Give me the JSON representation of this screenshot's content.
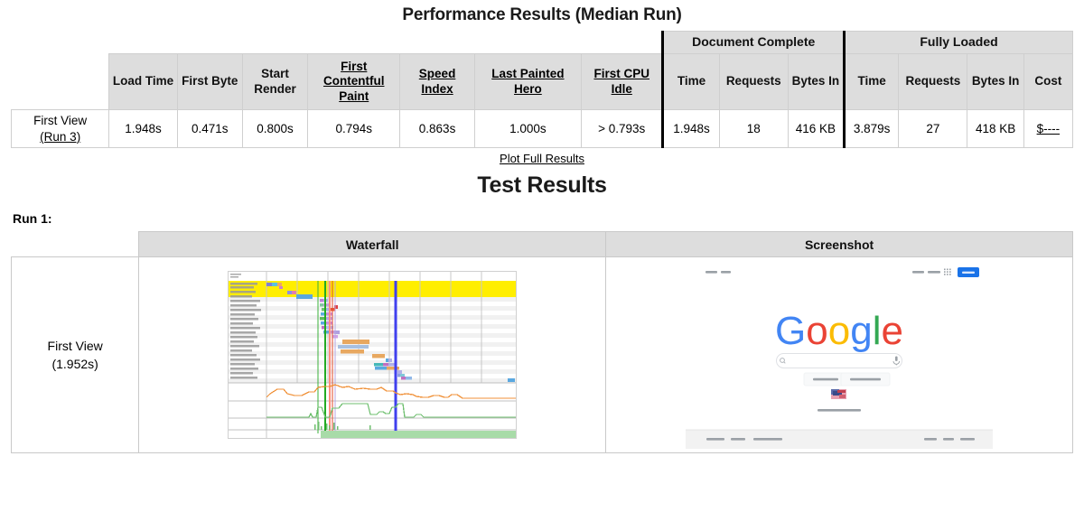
{
  "page": {
    "performance_title": "Performance Results (Median Run)",
    "test_results_title": "Test Results",
    "plot_full_results_link": "Plot Full Results",
    "run_label": "Run 1:"
  },
  "perf_table": {
    "group_headers": [
      {
        "label": "",
        "span": 8
      },
      {
        "label": "Document Complete",
        "span": 3
      },
      {
        "label": "Fully Loaded",
        "span": 4
      }
    ],
    "column_headers": [
      {
        "label": "",
        "link": false
      },
      {
        "label": "Load Time",
        "link": false
      },
      {
        "label": "First Byte",
        "link": false
      },
      {
        "label": "Start Render",
        "link": false
      },
      {
        "label": "First Contentful Paint",
        "link": true
      },
      {
        "label": "Speed Index",
        "link": true
      },
      {
        "label": "Last Painted Hero",
        "link": true
      },
      {
        "label": "First CPU Idle",
        "link": true
      },
      {
        "label": "Time",
        "link": false
      },
      {
        "label": "Requests",
        "link": false
      },
      {
        "label": "Bytes In",
        "link": false
      },
      {
        "label": "Time",
        "link": false
      },
      {
        "label": "Requests",
        "link": false
      },
      {
        "label": "Bytes In",
        "link": false
      },
      {
        "label": "Cost",
        "link": false
      }
    ],
    "row": {
      "view_label": "First View",
      "view_run_link": "(Run 3)",
      "load_time": "1.948s",
      "first_byte": "0.471s",
      "start_render": "0.800s",
      "first_contentful_paint": "0.794s",
      "speed_index": "0.863s",
      "last_painted_hero": "1.000s",
      "first_cpu_idle": "> 0.793s",
      "doc_complete_time": "1.948s",
      "doc_complete_requests": "18",
      "doc_complete_bytes_in": "416 KB",
      "fully_loaded_time": "3.879s",
      "fully_loaded_requests": "27",
      "fully_loaded_bytes_in": "418 KB",
      "cost": "$----"
    }
  },
  "results_table": {
    "headers": {
      "spacer": "",
      "waterfall": "Waterfall",
      "screenshot": "Screenshot"
    },
    "row": {
      "view_label": "First View",
      "view_time": "(1.952s)"
    }
  },
  "screenshot_thumb": {
    "nav_left": [
      "About",
      "Store"
    ],
    "nav_right": [
      "Gmail",
      "Images"
    ],
    "apps_icon": "apps-grid-icon",
    "signin_button": "Sign in",
    "logo_text": "Google",
    "logo_colors": [
      "#4285F4",
      "#EA4335",
      "#FBBC05",
      "#4285F4",
      "#34A853",
      "#EA4335"
    ],
    "search_icon": "search-icon",
    "mic_icon": "microphone-icon",
    "buttons": [
      "Google Search",
      "I'm Feeling Lucky"
    ],
    "doodle_caption": "Google offered in: Deutsch",
    "footer_left": [
      "Advertising",
      "Business",
      "How Search works"
    ],
    "footer_right": [
      "Privacy",
      "Terms",
      "Settings"
    ],
    "accent_blue": "#1a73e8"
  },
  "waterfall": {
    "colors": {
      "header_band": "#ffe600",
      "row_alt": "#f2f2f2",
      "grid": "#cccccc",
      "start_render_line": "#00aa00",
      "dom_line": "#ff4040",
      "load_line": "#3030ff",
      "cpu_line": "#ff9933",
      "bandwidth_line": "#66bb66",
      "bottom_band": "#a8dba8"
    }
  }
}
